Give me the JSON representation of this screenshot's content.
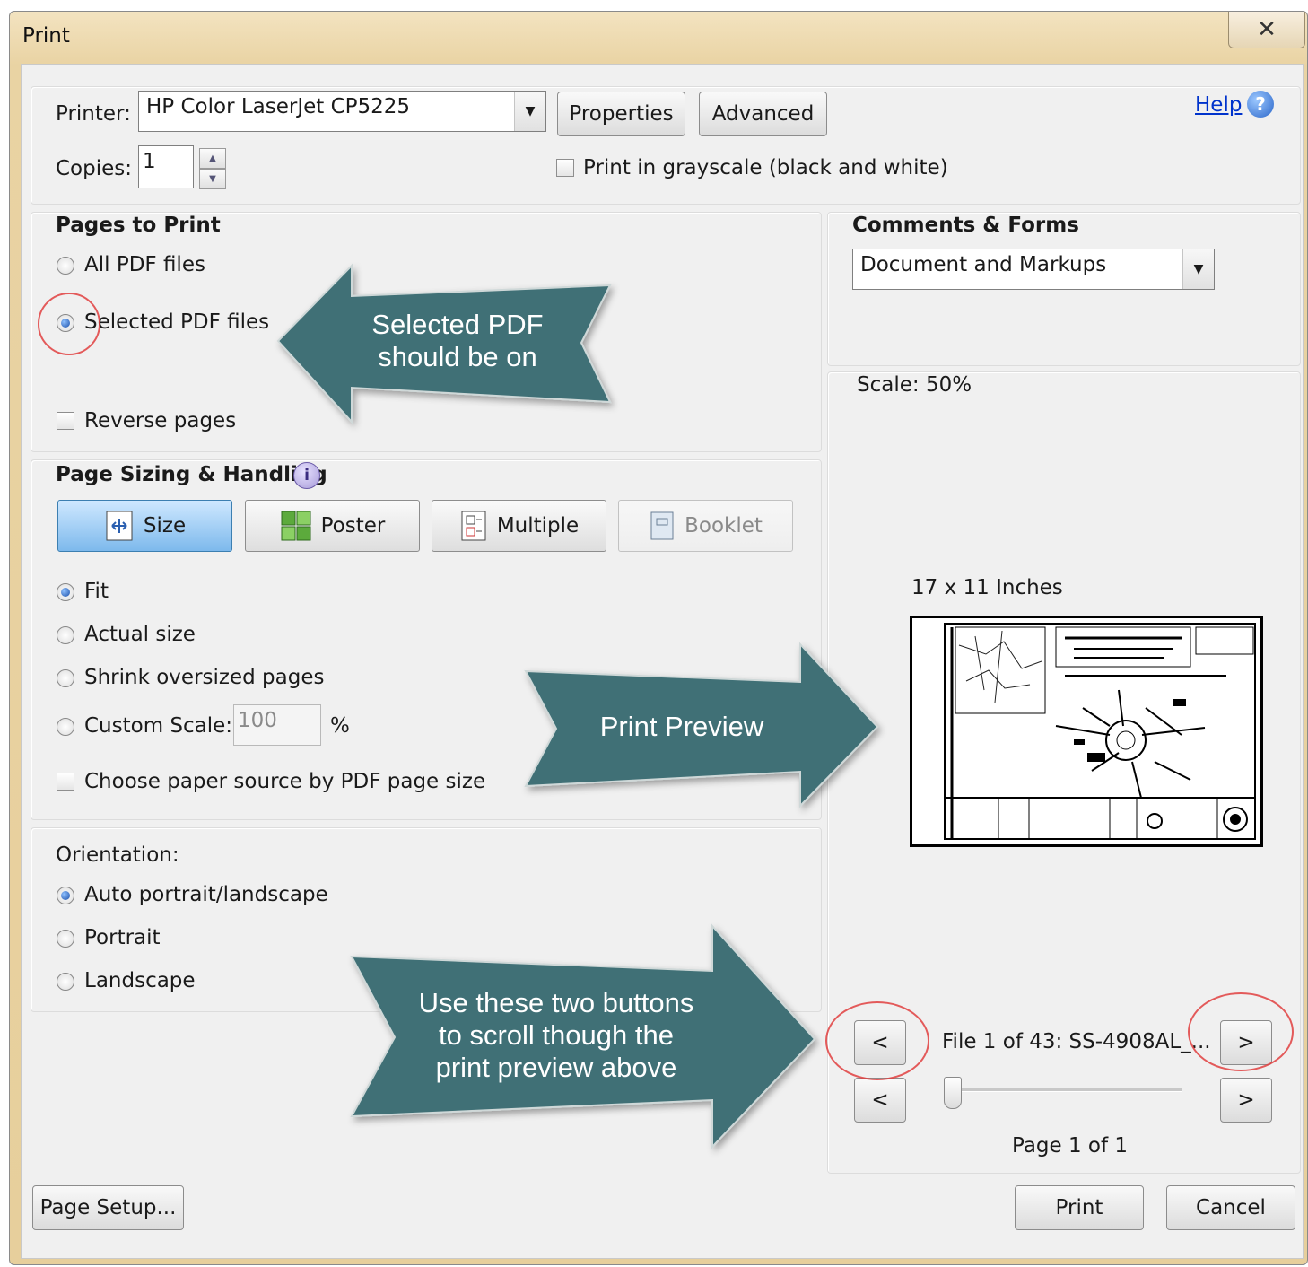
{
  "window": {
    "title": "Print",
    "close_glyph": "✕"
  },
  "printer": {
    "label": "Printer:",
    "selected": "HP Color LaserJet CP5225",
    "properties_label": "Properties",
    "advanced_label": "Advanced",
    "help_label": "Help",
    "copies_label": "Copies:",
    "copies_value": "1",
    "grayscale_label": "Print in grayscale (black and white)",
    "grayscale_checked": false
  },
  "pages_to_print": {
    "heading": "Pages to Print",
    "options": [
      "All PDF files",
      "Selected PDF files"
    ],
    "selected": "Selected PDF files",
    "reverse_label": "Reverse pages",
    "reverse_checked": false
  },
  "sizing": {
    "heading": "Page Sizing & Handling",
    "tabs": [
      "Size",
      "Poster",
      "Multiple",
      "Booklet"
    ],
    "active_tab": "Size",
    "disabled_tab": "Booklet",
    "options": [
      "Fit",
      "Actual size",
      "Shrink oversized pages",
      "Custom Scale:"
    ],
    "selected": "Fit",
    "custom_scale_value": "100",
    "percent_label": "%",
    "paper_source_label": "Choose paper source by PDF page size",
    "paper_source_checked": false
  },
  "orientation": {
    "heading": "Orientation:",
    "options": [
      "Auto portrait/landscape",
      "Portrait",
      "Landscape"
    ],
    "selected": "Auto portrait/landscape"
  },
  "comments_forms": {
    "heading": "Comments & Forms",
    "selected": "Document and Markups"
  },
  "preview": {
    "scale_label": "Scale:  50%",
    "size_label": "17 x 11 Inches",
    "file_label": "File 1 of 43: SS-4908AL_...",
    "page_label": "Page 1 of 1",
    "prev_glyph": "<",
    "next_glyph": ">"
  },
  "callouts": {
    "selected_pdf": "Selected PDF should be on",
    "print_preview": "Print Preview",
    "scroll_buttons": "Use these two buttons to scroll though the print preview above"
  },
  "footer": {
    "page_setup_label": "Page Setup...",
    "print_label": "Print",
    "cancel_label": "Cancel"
  },
  "colors": {
    "callout_fill": "#3f7076",
    "active_tab": "#7db9ec",
    "help_link": "#0033cc",
    "circle_red": "#e04040"
  }
}
